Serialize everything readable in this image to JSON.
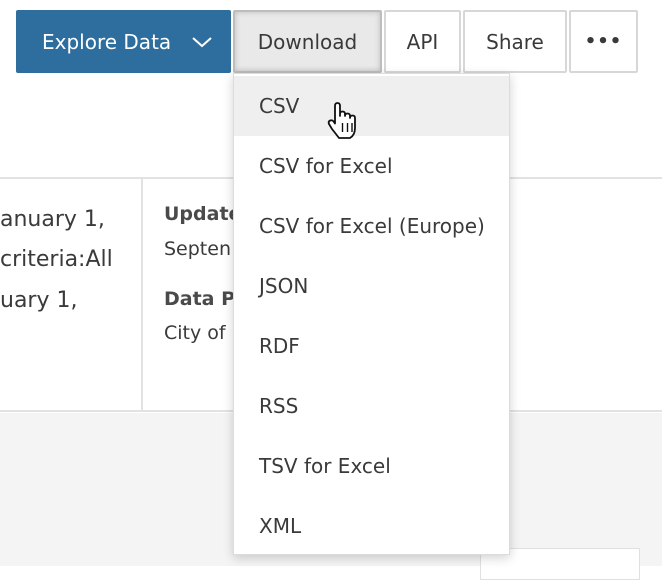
{
  "toolbar": {
    "explore_label": "Explore Data",
    "download_label": "Download",
    "api_label": "API",
    "share_label": "Share",
    "more_label": "•••",
    "primary_color": "#2e6e9e"
  },
  "background": {
    "left_lines": [
      "anuary 1,",
      "criteria:All",
      "uary 1,"
    ],
    "meta": [
      {
        "label": "Update",
        "value": "Septen"
      },
      {
        "label": "Data P",
        "value": "City of"
      }
    ]
  },
  "download_menu": {
    "items": [
      {
        "label": "CSV"
      },
      {
        "label": "CSV for Excel"
      },
      {
        "label": "CSV for Excel (Europe)"
      },
      {
        "label": "JSON"
      },
      {
        "label": "RDF"
      },
      {
        "label": "RSS"
      },
      {
        "label": "TSV for Excel"
      },
      {
        "label": "XML"
      }
    ]
  },
  "icons": {
    "explore_chevron": "chevron-down-icon",
    "cursor": "hand-pointer-icon"
  }
}
